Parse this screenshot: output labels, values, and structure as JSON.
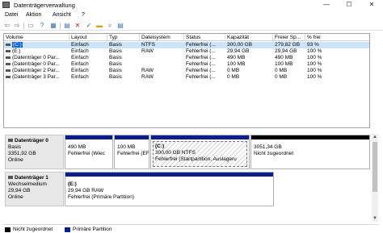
{
  "window": {
    "title": "Datenträgerverwaltung",
    "min": "—",
    "max": "☐",
    "close": "✕"
  },
  "menu": [
    "Datei",
    "Aktion",
    "Ansicht",
    "?"
  ],
  "toolbar": {
    "back": "⇦",
    "forward": "⇨",
    "up": "▭",
    "help": "?",
    "grid": "▦",
    "delete": "✕",
    "check": "✓",
    "folder": "▬",
    "search": "⌕",
    "props": "▤"
  },
  "table": {
    "headers": [
      "Volume",
      "Layout",
      "Typ",
      "Dateisystem",
      "Status",
      "Kapazität",
      "Freier Sp...",
      "% frei"
    ],
    "rows": [
      [
        "(C:)",
        "Einfach",
        "Basis",
        "NTFS",
        "Fehlerfrei (...",
        "300,00 GB",
        "279,82 GB",
        "93 %"
      ],
      [
        "(E:)",
        "Einfach",
        "Basis",
        "RAW",
        "Fehlerfrei (...",
        "29,94 GB",
        "29,94 GB",
        "100 %"
      ],
      [
        "(Datenträger 0 Par...",
        "Einfach",
        "Basis",
        "",
        "Fehlerfrei (...",
        "490 MB",
        "490 MB",
        "100 %"
      ],
      [
        "(Datenträger 0 Par...",
        "Einfach",
        "Basis",
        "",
        "Fehlerfrei (...",
        "100 MB",
        "100 MB",
        "100 %"
      ],
      [
        "(Datenträger 2 Par...",
        "Einfach",
        "Basis",
        "RAW",
        "Fehlerfrei (...",
        "0 MB",
        "0 MB",
        "100 %"
      ],
      [
        "(Datenträger 3 Par...",
        "Einfach",
        "Basis",
        "RAW",
        "Fehlerfrei (...",
        "0 MB",
        "0 MB",
        "100 %"
      ]
    ]
  },
  "disks": [
    {
      "name": "Datenträger 0",
      "type": "Basis",
      "size": "3351,92 GB",
      "state": "Online",
      "partitions": [
        {
          "title": "",
          "line1": "490 MB",
          "line2": "Fehlerfrei (Wiec"
        },
        {
          "title": "",
          "line1": "100 MB",
          "line2": "Fehlerfrei (EFI-"
        },
        {
          "title": "(C:)",
          "line1": "300,00 GB NTFS",
          "line2": "Fehlerfrei (Startpartition, Auslageru"
        },
        {
          "title": "",
          "line1": "3051,34 GB",
          "line2": "Nicht zugeordnet"
        }
      ]
    },
    {
      "name": "Datenträger 1",
      "type": "Wechselmedium",
      "size": "29,94 GB",
      "state": "Online",
      "partitions": [
        {
          "title": "(E:)",
          "line1": "29,94 GB RAW",
          "line2": "Fehlerfrei (Primäre Partition)"
        }
      ]
    }
  ],
  "legend": [
    {
      "label": "Nicht zugeordnet",
      "color": "#000000"
    },
    {
      "label": "Primäre Partition",
      "color": "#0b1e8a"
    }
  ],
  "colors": {
    "primary": "#0b1e8a",
    "unallocated": "#000000",
    "selection": "#cce4f7"
  }
}
